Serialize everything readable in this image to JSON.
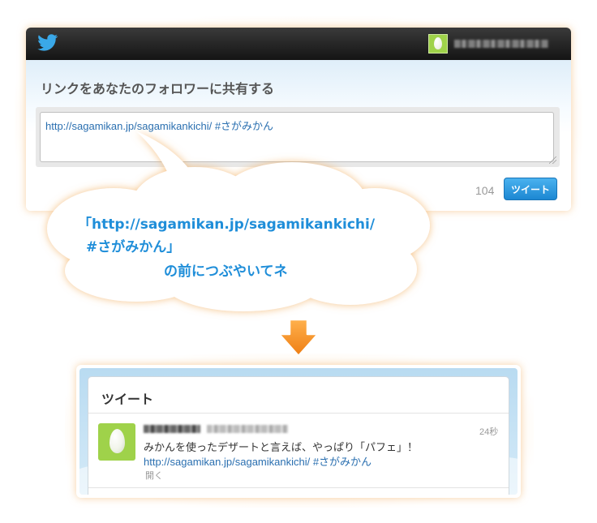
{
  "compose": {
    "heading": "リンクをあなたのフォロワーに共有する",
    "textarea_value": "http://sagamikan.jp/sagamikankichi/ #さがみかん",
    "char_count": "104",
    "tweet_button": "ツイート"
  },
  "bubble": {
    "line1": "「http://sagamikan.jp/sagamikankichi/",
    "line2": "#さがみかん」",
    "line3": "の前につぶやいてネ"
  },
  "timeline": {
    "title": "ツイート",
    "tweet": {
      "time": "24秒",
      "text": "みかんを使ったデザートと言えば、やっぱり「パフェ」！",
      "link": "http://sagamikan.jp/sagamikankichi/ #さがみかん",
      "open_label": "開く"
    }
  },
  "colors": {
    "accent": "#1f8ed9",
    "button": "#2a9be4",
    "arrow": "#f08c1e",
    "avatar": "#9fd24a"
  }
}
